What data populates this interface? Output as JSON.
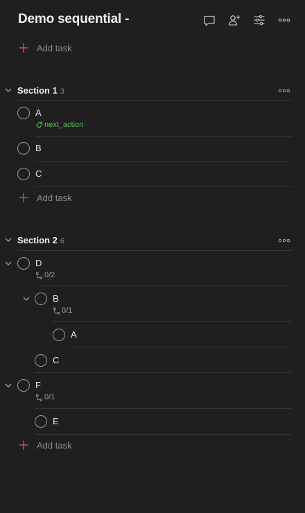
{
  "project": {
    "title": "Demo sequential -"
  },
  "header_icons": [
    "comment-icon",
    "add-person-icon",
    "view-options-icon",
    "more-icon"
  ],
  "add_task_label": "Add task",
  "sections": [
    {
      "name": "Section 1",
      "count": "3",
      "tasks": [
        {
          "name": "A",
          "label": "next_action"
        },
        {
          "name": "B"
        },
        {
          "name": "C"
        }
      ]
    },
    {
      "name": "Section 2",
      "count": "6",
      "tasks": [
        {
          "name": "D",
          "subtasks": "0/2"
        },
        {
          "name": "B",
          "subtasks": "0/1"
        },
        {
          "name": "A"
        },
        {
          "name": "C"
        },
        {
          "name": "F",
          "subtasks": "0/1"
        },
        {
          "name": "E"
        }
      ]
    }
  ],
  "colors": {
    "background": "#1f1f1f",
    "accent": "#dc4c3e",
    "label": "#5ec35a"
  }
}
